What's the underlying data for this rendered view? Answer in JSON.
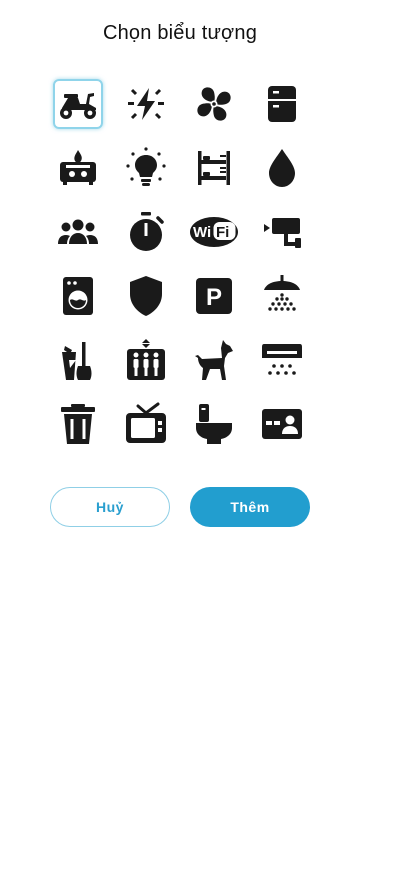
{
  "dialog": {
    "title": "Chọn biểu tượng",
    "cancel_label": "Huỷ",
    "add_label": "Thêm"
  },
  "icons": [
    {
      "name": "scooter-icon",
      "selected": true
    },
    {
      "name": "electricity-icon"
    },
    {
      "name": "fan-icon"
    },
    {
      "name": "fridge-icon"
    },
    {
      "name": "gas-stove-icon"
    },
    {
      "name": "lightbulb-icon"
    },
    {
      "name": "bunk-bed-icon"
    },
    {
      "name": "water-drop-icon"
    },
    {
      "name": "group-icon"
    },
    {
      "name": "timer-icon"
    },
    {
      "name": "wifi-icon",
      "text": "WiFi"
    },
    {
      "name": "security-camera-icon"
    },
    {
      "name": "washing-machine-icon"
    },
    {
      "name": "shield-icon"
    },
    {
      "name": "parking-icon",
      "text": "P"
    },
    {
      "name": "shower-icon"
    },
    {
      "name": "cleaning-icon"
    },
    {
      "name": "elevator-icon"
    },
    {
      "name": "pet-dog-icon"
    },
    {
      "name": "air-conditioner-icon"
    },
    {
      "name": "trash-bin-icon"
    },
    {
      "name": "television-icon"
    },
    {
      "name": "toilet-icon"
    },
    {
      "name": "id-card-icon"
    }
  ],
  "colors": {
    "accent": "#229ecf",
    "icon": "#1a1a1a",
    "selected_border": "#8fd4ea"
  }
}
